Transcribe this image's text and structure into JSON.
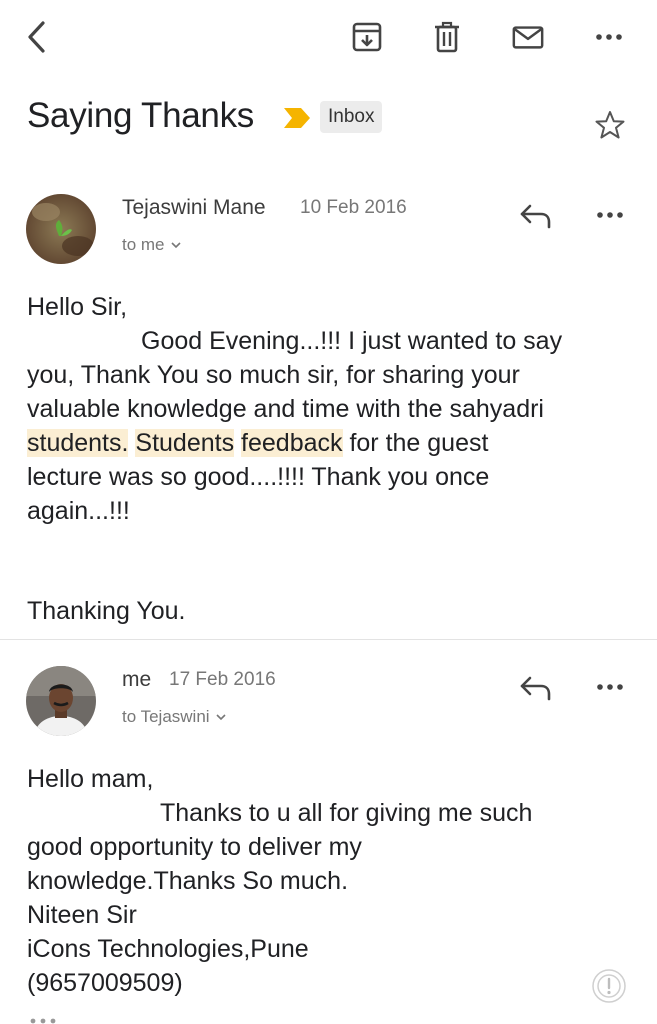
{
  "toolbar": {
    "back_icon": "chevron-left-icon",
    "archive_icon": "archive-icon",
    "delete_icon": "trash-icon",
    "unread_icon": "mail-icon",
    "more_icon": "more-horizontal-icon"
  },
  "subject": "Saying Thanks",
  "label": "Inbox",
  "colors": {
    "importance_marker": "#f5b400",
    "highlight": "#fbeed3"
  },
  "messages": [
    {
      "sender": "Tejaswini Mane",
      "date": "10 Feb 2016",
      "recipient": "to me",
      "body": {
        "line1": "Hello Sir,",
        "line2": "Good Evening...!!! I just wanted to say",
        "line3": "you, Thank You so much sir, for sharing your",
        "line4": "valuable knowledge and time with the sahyadri",
        "line5_hl1": "students.",
        "line5_hl2": "Students",
        "line5_hl3": "feedback",
        "line5_rest": " for the guest",
        "line6": "lecture was so good....!!!! Thank you once",
        "line7": "again...!!!",
        "line8": "Thanking You."
      }
    },
    {
      "sender": "me",
      "date": "17 Feb 2016",
      "recipient": "to Tejaswini",
      "body": {
        "line1": "Hello mam,",
        "line2": "Thanks to u all for giving me such",
        "line3": "good opportunity to deliver my",
        "line4": "knowledge.Thanks So much.",
        "line5": "Niteen Sir",
        "line6": "iCons Technologies,Pune",
        "line7": "(9657009509)"
      }
    }
  ]
}
